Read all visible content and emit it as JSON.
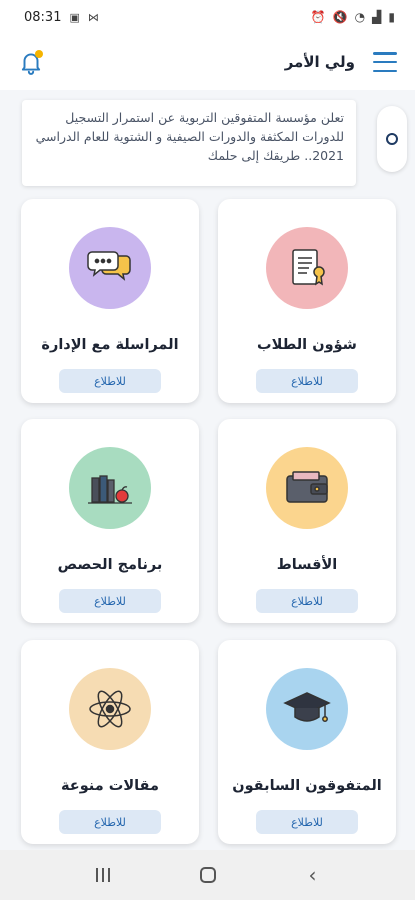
{
  "status_bar": {
    "time": "08:31",
    "icons": [
      "image-icon",
      "nfc-icon",
      "alarm-icon",
      "mute-icon",
      "wifi-icon",
      "signal-icon",
      "battery-icon"
    ]
  },
  "app_bar": {
    "title": "ولي الأمر",
    "bell_badge_color": "#f5b400",
    "accent": "#2a7bbf"
  },
  "news": {
    "text": "تعلن مؤسسة المتفوقين التربوية عن استمرار التسجيل للدورات المكثفة والدورات الصيفية و الشتوية للعام الدراسي 2021.. طريقك إلى حلمك"
  },
  "cards": [
    {
      "title": "شؤون الطلاب",
      "button": "للاطلاع",
      "icon": "certificate-icon",
      "color": "#f2b6b9"
    },
    {
      "title": "المراسلة مع الإدارة",
      "button": "للاطلاع",
      "icon": "chat-bubbles-icon",
      "color": "#c9b6ee"
    },
    {
      "title": "الأقساط",
      "button": "للاطلاع",
      "icon": "wallet-icon",
      "color": "#fbd58e"
    },
    {
      "title": "برنامج الحصص",
      "button": "للاطلاع",
      "icon": "books-apple-icon",
      "color": "#a8dcc0"
    },
    {
      "title": "المتفوقون السابقون",
      "button": "للاطلاع",
      "icon": "graduation-cap-icon",
      "color": "#a9d4ef"
    },
    {
      "title": "مقالات منوعة",
      "button": "للاطلاع",
      "icon": "atom-icon",
      "color": "#f6dcb3"
    }
  ],
  "nav": {
    "recents": "recents-icon",
    "home": "home-icon",
    "back": "back-icon"
  }
}
